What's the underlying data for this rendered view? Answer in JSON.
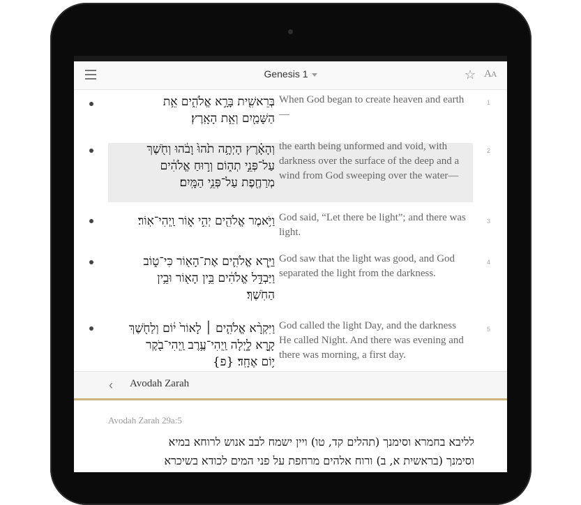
{
  "header": {
    "title": "Genesis 1"
  },
  "verses": [
    {
      "num": "1",
      "he": [
        "בְּרֵאשִׁ֖ית בָּרָ֣א אֱלֹהִ֑ים אֵ֥ת",
        "הַשָּׁמַ֖יִם וְאֵ֥ת הָאָֽרֶץ׃"
      ],
      "en": "When God began to create heaven and earth—"
    },
    {
      "num": "2",
      "he": [
        "וְהָאָ֗רֶץ הָיְתָ֥ה תֹ֙הוּ֙ וָבֹ֔הוּ וְחֹ֖שֶׁךְ",
        "עַל־פְּנֵ֣י תְה֑וֹם וְר֣וּחַ אֱלֹהִ֔ים",
        "מְרַחֶ֖פֶת עַל־פְּנֵ֥י הַמָּֽיִם׃"
      ],
      "en": "the earth being unformed and void, with darkness over the surface of the deep and a wind from God sweeping over the water—"
    },
    {
      "num": "3",
      "he": [
        "וַיֹּ֥אמֶר אֱלֹהִ֖ים יְהִ֣י א֑וֹר וַֽיְהִי־אֽוֹר׃"
      ],
      "en": "God said, “Let there be light”; and there was light."
    },
    {
      "num": "4",
      "he": [
        "וַיַּ֧רְא אֱלֹהִ֛ים אֶת־הָא֖וֹר כִּי־ט֑וֹב",
        "וַיַּבְדֵּ֣ל אֱלֹהִ֔ים בֵּ֥ין הָא֖וֹר וּבֵ֥ין",
        "הַחֹֽשֶׁךְ׃"
      ],
      "en": "God saw that the light was good, and God separated the light from the darkness."
    },
    {
      "num": "5",
      "he": [
        "וַיִּקְרָ֨א אֱלֹהִ֤ים ׀ לָאוֹר֙ י֔וֹם וְלַחֹ֖שֶׁךְ",
        "קָ֣רָא לָ֑יְלָה וַֽיְהִי־עֶ֥רֶב וַֽיְהִי־בֹ֖קֶר",
        "י֥וֹם אֶחָֽד׃ {פ}"
      ],
      "en": "God called the light Day, and the darkness He called Night. And there was evening and there was morning, a first day."
    }
  ],
  "connection": {
    "title": "Avodah Zarah",
    "ref": "Avodah Zarah 29a:5",
    "text": [
      "לליבא בחמרא וסימנך (תהלים קד, טו) ויין ישמח לבב אנוש לרוחא במיא",
      "וסימנך (בראשית א, ב) ורוח אלהים מרחפת על פני המים לכודא בשיכרא"
    ]
  },
  "icons": {
    "menu": "menu-icon",
    "star": "star-icon",
    "font": "font-size-icon",
    "back": "back-chevron-icon"
  }
}
